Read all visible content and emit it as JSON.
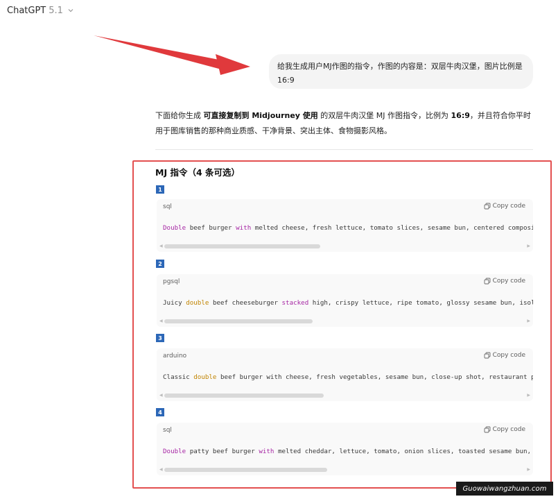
{
  "header": {
    "title": "ChatGPT",
    "version": "5.1"
  },
  "user_message": "给我生成用户MJ作图的指令，作图的内容是：双层牛肉汉堡，图片比例是16:9",
  "answer": {
    "intro_pre": "下面给你生成 ",
    "intro_bold1": "可直接复制到 Midjourney 使用",
    "intro_mid": " 的双层牛肉汉堡 MJ 作图指令，比例为 ",
    "intro_bold2": "16:9",
    "intro_post": "，并且符合你平时用于图库销售的那种商业质感、干净背景、突出主体、食物摄影风格。",
    "section_heading": "MJ 指令（4 条可选）",
    "copy_label": "Copy code",
    "blocks": [
      {
        "number": "1",
        "lang": "sql",
        "kw": "Double",
        "mid1": " beef burger ",
        "kw2": "with",
        "rest": " melted cheese, fresh lettuce, tomato slices, sesame bun, centered composit",
        "scroll_fraction": 0.42
      },
      {
        "number": "2",
        "lang": "pgsql",
        "pre": "Juicy ",
        "kw": "double",
        "mid1": " beef cheeseburger ",
        "kw2": "stacked",
        "rest": " high, crispy lettuce, ripe tomato, glossy sesame bun, isola",
        "scroll_fraction": 0.4
      },
      {
        "number": "3",
        "lang": "arduino",
        "pre": "Classic ",
        "kw": "double",
        "rest": " beef burger with cheese, fresh vegetables, sesame bun, close-up shot, restaurant pr",
        "scroll_fraction": 0.43
      },
      {
        "number": "4",
        "lang": "sql",
        "kw": "Double",
        "mid1": " patty beef burger ",
        "kw2": "with",
        "rest": " melted cheddar, lettuce, tomato, onion slices, toasted sesame bun, c",
        "scroll_fraction": 0.44
      }
    ]
  },
  "watermark": "Guowaiwangzhuan.com",
  "colors": {
    "highlight_border": "#e34f4f",
    "arrow": "#e0393c",
    "badge": "#2c67b7",
    "keyword_purple": "#a626a4",
    "keyword_gold": "#c18401"
  },
  "icons": {
    "copy": "copy-icon",
    "chevron": "chevron-down-icon"
  }
}
